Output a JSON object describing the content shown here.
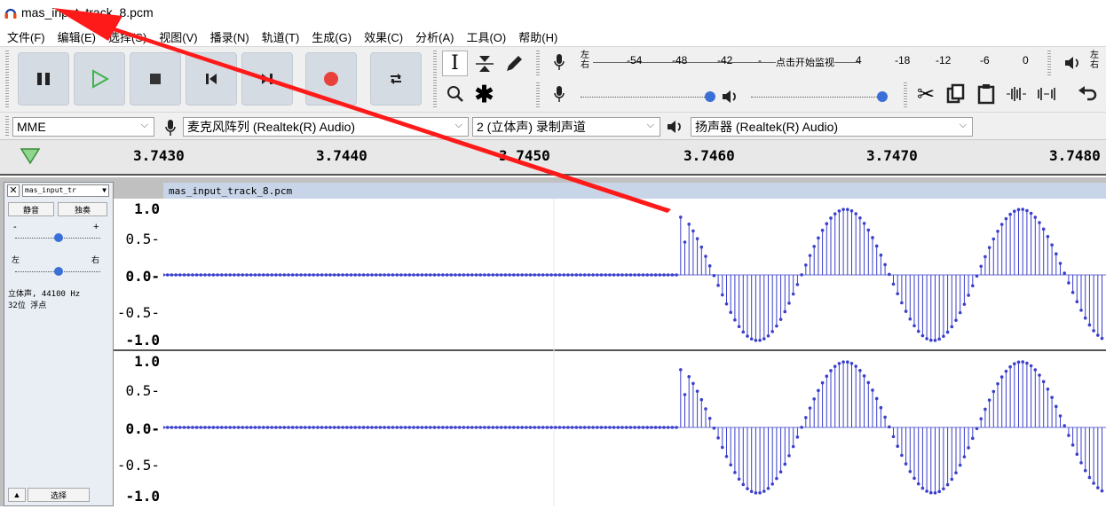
{
  "window": {
    "title": "mas_input_track_8.pcm"
  },
  "menus": [
    "文件(F)",
    "编辑(E)",
    "选择(S)",
    "视图(V)",
    "播录(N)",
    "轨道(T)",
    "生成(G)",
    "效果(C)",
    "分析(A)",
    "工具(O)",
    "帮助(H)"
  ],
  "meter": {
    "lr_top": "左",
    "lr_bottom": "右",
    "scale": [
      "-54",
      "-48",
      "-42",
      "-",
      "点击开始监视",
      "4",
      "-18",
      "-12",
      "-6",
      "0"
    ],
    "play_lr_top": "左",
    "play_lr_bottom": "右"
  },
  "devices": {
    "host": "MME",
    "input": "麦克风阵列 (Realtek(R) Audio)",
    "channels": "2 (立体声) 录制声道",
    "output": "扬声器 (Realtek(R) Audio)"
  },
  "timeline": {
    "ticks": [
      "3.7430",
      "3.7440",
      "3.7450",
      "3.7460",
      "3.7470",
      "3.7480"
    ]
  },
  "track": {
    "name": "mas_input_tr",
    "clip_name": "mas_input_track_8.pcm",
    "mute": "静音",
    "solo": "独奏",
    "gain_minus": "-",
    "gain_plus": "+",
    "pan_left": "左",
    "pan_right": "右",
    "info_line1": "立体声, 44100 Hz",
    "info_line2": "32位 浮点",
    "select": "选择",
    "vticks": [
      "1.0",
      "0.5-",
      "0.0-",
      "-0.5-",
      "-1.0"
    ],
    "vticks_b": [
      "1.0",
      "0.5-",
      "0.0-",
      "-0.5-",
      "-1.0"
    ]
  },
  "colors": {
    "wave": "#3a3fcc",
    "arrow": "#ff1a1a",
    "record": "#e8413c",
    "play": "#3cb44a"
  }
}
